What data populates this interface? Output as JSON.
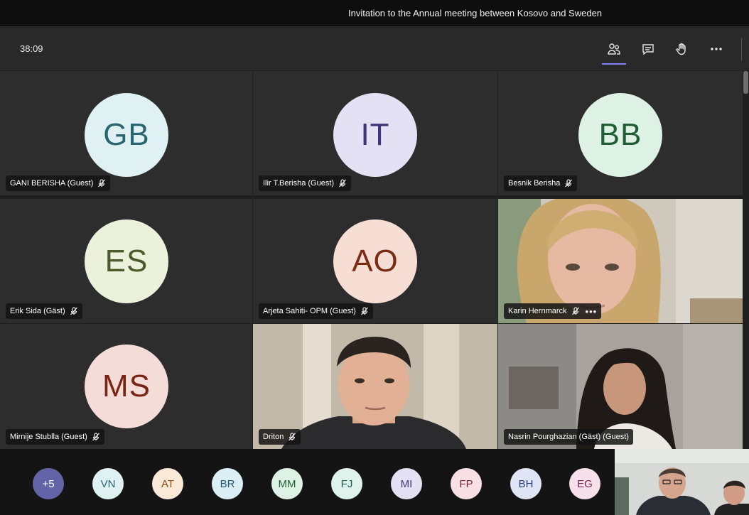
{
  "window": {
    "title": "Invitation to the Annual meeting between Kosovo and Sweden"
  },
  "toolbar": {
    "timer": "38:09",
    "buttons": [
      {
        "name": "participants-icon",
        "active": true
      },
      {
        "name": "chat-icon",
        "active": false
      },
      {
        "name": "raise-hand-icon",
        "active": false
      },
      {
        "name": "more-options-icon",
        "active": false
      }
    ]
  },
  "participants": [
    {
      "name": "GANI BERISHA (Guest)",
      "initials": "GB",
      "avatar_bg": "#dff1f2",
      "avatar_fg": "#2a6670",
      "muted": true,
      "video": false
    },
    {
      "name": "Ilir T.Berisha (Guest)",
      "initials": "IT",
      "avatar_bg": "#e3e1f3",
      "avatar_fg": "#3d3778",
      "muted": true,
      "video": false
    },
    {
      "name": "Besnik Berisha",
      "initials": "BB",
      "avatar_bg": "#ddf2e4",
      "avatar_fg": "#1f5e35",
      "muted": true,
      "video": false
    },
    {
      "name": "Erik Sida (Gäst)",
      "initials": "ES",
      "avatar_bg": "#ecf1dc",
      "avatar_fg": "#4b5a2a",
      "muted": true,
      "video": false
    },
    {
      "name": "Arjeta Sahiti- OPM (Guest)",
      "initials": "AO",
      "avatar_bg": "#f6ded5",
      "avatar_fg": "#7a2b14",
      "muted": true,
      "video": false
    },
    {
      "name": "Karin Hernmarck",
      "initials": "",
      "muted": true,
      "video": true,
      "more": "•••"
    },
    {
      "name": "Mirnije Stublla (Guest)",
      "initials": "MS",
      "avatar_bg": "#f4ddd8",
      "avatar_fg": "#7a2414",
      "muted": true,
      "video": false
    },
    {
      "name": "Driton",
      "initials": "",
      "muted": true,
      "video": true
    },
    {
      "name": "Nasrin Pourghazian (Gäst) (Guest)",
      "initials": "",
      "muted": false,
      "video": true
    }
  ],
  "tray": {
    "overflow_label": "+5",
    "overflow_bg": "#6264a7",
    "avatars": [
      {
        "initials": "VN",
        "bg": "#dff1f2",
        "fg": "#2a6670"
      },
      {
        "initials": "AT",
        "bg": "#fbe9d8",
        "fg": "#8a4a10"
      },
      {
        "initials": "BR",
        "bg": "#dceef5",
        "fg": "#235a70"
      },
      {
        "initials": "MM",
        "bg": "#ddf2e4",
        "fg": "#1f5e35"
      },
      {
        "initials": "FJ",
        "bg": "#dff3ec",
        "fg": "#1b5e4c"
      },
      {
        "initials": "MI",
        "bg": "#e3e1f3",
        "fg": "#3d3778"
      },
      {
        "initials": "FP",
        "bg": "#f8e0e4",
        "fg": "#7a2434"
      },
      {
        "initials": "BH",
        "bg": "#e0e5f5",
        "fg": "#2d3d78"
      },
      {
        "initials": "EG",
        "bg": "#f6e0ea",
        "fg": "#7a2450"
      }
    ]
  }
}
